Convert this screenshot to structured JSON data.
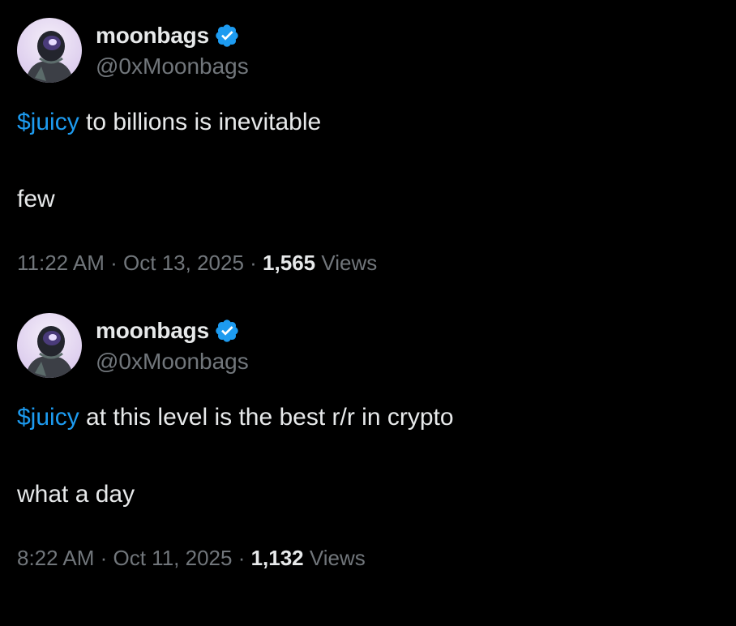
{
  "colors": {
    "background": "#000000",
    "text_primary": "#e7e9ea",
    "text_secondary": "#71767b",
    "link": "#1d9bf0",
    "verified_badge": "#1d9bf0"
  },
  "tweets": [
    {
      "author": {
        "display_name": "moonbags",
        "handle": "@0xMoonbags",
        "verified": true,
        "avatar_icon": "astronaut-avatar"
      },
      "lines": [
        {
          "cashtag": "$juicy",
          "text": " to billions is inevitable"
        },
        {
          "cashtag": "",
          "text": "few"
        }
      ],
      "time": "11:22 AM",
      "separator": " · ",
      "date": "Oct 13, 2025",
      "views_count": "1,565",
      "views_label": " Views"
    },
    {
      "author": {
        "display_name": "moonbags",
        "handle": "@0xMoonbags",
        "verified": true,
        "avatar_icon": "astronaut-avatar"
      },
      "lines": [
        {
          "cashtag": "$juicy",
          "text": " at this level is the best r/r in crypto"
        },
        {
          "cashtag": "",
          "text": "what a day"
        }
      ],
      "time": "8:22 AM",
      "separator": " · ",
      "date": "Oct 11, 2025",
      "views_count": "1,132",
      "views_label": " Views"
    }
  ]
}
